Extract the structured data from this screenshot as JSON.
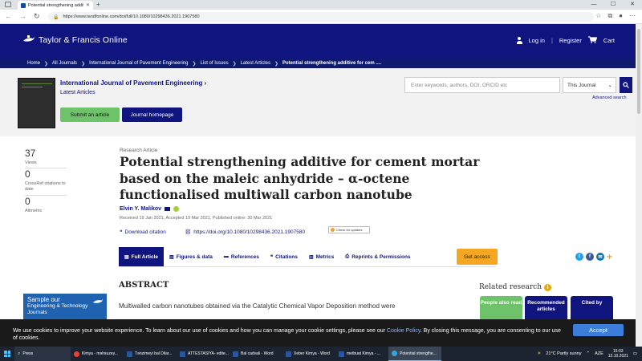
{
  "browser": {
    "tab_title": "Potential strengthening additive",
    "url": "https://www.tandfonline.com/doi/full/10.1080/10298436.2021.1907580"
  },
  "header": {
    "logo_text": "Taylor & Francis Online",
    "login": "Log in",
    "register": "Register",
    "cart": "Cart"
  },
  "breadcrumb": [
    "Home",
    "All Journals",
    "International Journal of Pavement Engineering",
    "List of Issues",
    "Latest Articles",
    "Potential strengthening additive for cem ...."
  ],
  "journal": {
    "title": "International Journal of Pavement Engineering",
    "latest": "Latest Articles",
    "submit": "Submit an article",
    "homepage": "Journal homepage"
  },
  "search": {
    "placeholder": "Enter keywords, authors, DOI, ORCID etc",
    "scope": "This Journal",
    "advanced": "Advanced search"
  },
  "metrics": [
    {
      "value": "37",
      "label": "Views"
    },
    {
      "value": "0",
      "label": "CrossRef citations to date"
    },
    {
      "value": "0",
      "label": "Altmetric"
    }
  ],
  "article": {
    "kind": "Research Article",
    "title": "Potential strengthening additive for cement mortar based on the maleic anhydride – α-octene functionalised multiwall carbon nanotube",
    "author": "Elvin Y. Malikov",
    "dates": "Received 19 Jan 2021, Accepted 19 Mar 2021, Published online: 30 Mar 2021",
    "download_citation": "Download citation",
    "doi": "https://doi.org/10.1080/10298436.2021.1907580",
    "check_updates": "Check for updates"
  },
  "tabs": [
    "Full Article",
    "Figures & data",
    "References",
    "Citations",
    "Metrics",
    "Reprints & Permissions"
  ],
  "get_access": "Get access",
  "abstract": {
    "heading": "ABSTRACT",
    "first_line": "Multiwalled carbon nanotubes obtained via the Catalytic Chemical Vapor Deposition method were"
  },
  "promo": {
    "line1": "Sample our",
    "line2": "Engineering & Technology",
    "line3": "Journals"
  },
  "related": {
    "heading": "Related research",
    "tabs": [
      "People also read",
      "Recommended articles",
      "Cited by"
    ]
  },
  "cookie": {
    "text_before": "We use cookies to improve your website experience. To learn about our use of cookies and how you can manage your cookie settings, please see our ",
    "link": "Cookie Policy",
    "text_after": ". By closing this message, you are consenting to our use of cookies.",
    "accept": "Accept"
  },
  "taskbar": {
    "search": "Press",
    "items": [
      "Kimya - məhsuzey...",
      "Tənzimeyi bal Dilar...",
      "ATTESTASIYA- edite...",
      "Bal cadvali - Word",
      "Xeber Kimya - Word",
      "metbuat Kimya - ...",
      "Potential strengthe..."
    ],
    "weather": "21°C  Partly sunny",
    "lang": "AZE",
    "time": "15:03",
    "date": "12.10.2021"
  },
  "colors": {
    "brand": "#10147e",
    "green": "#6ec26a",
    "orange": "#f5a623"
  }
}
